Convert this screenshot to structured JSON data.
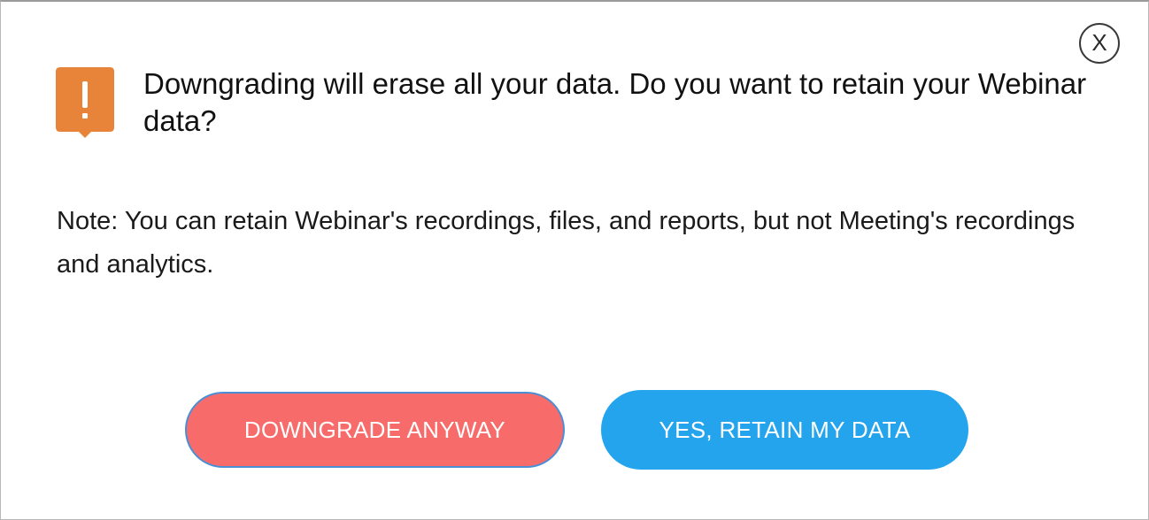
{
  "dialog": {
    "close_label": "X",
    "title": "Downgrading will erase all your data. Do you want to retain your Webinar data?",
    "note": "Note: You can retain Webinar's recordings, files, and reports, but not Meeting's recordings and analytics.",
    "icon": "warning-icon",
    "buttons": {
      "downgrade_label": "DOWNGRADE ANYWAY",
      "retain_label": "YES, RETAIN MY DATA"
    }
  },
  "colors": {
    "warning_icon": "#e8843a",
    "downgrade_button": "#f86b6b",
    "retain_button": "#25a4ee"
  }
}
